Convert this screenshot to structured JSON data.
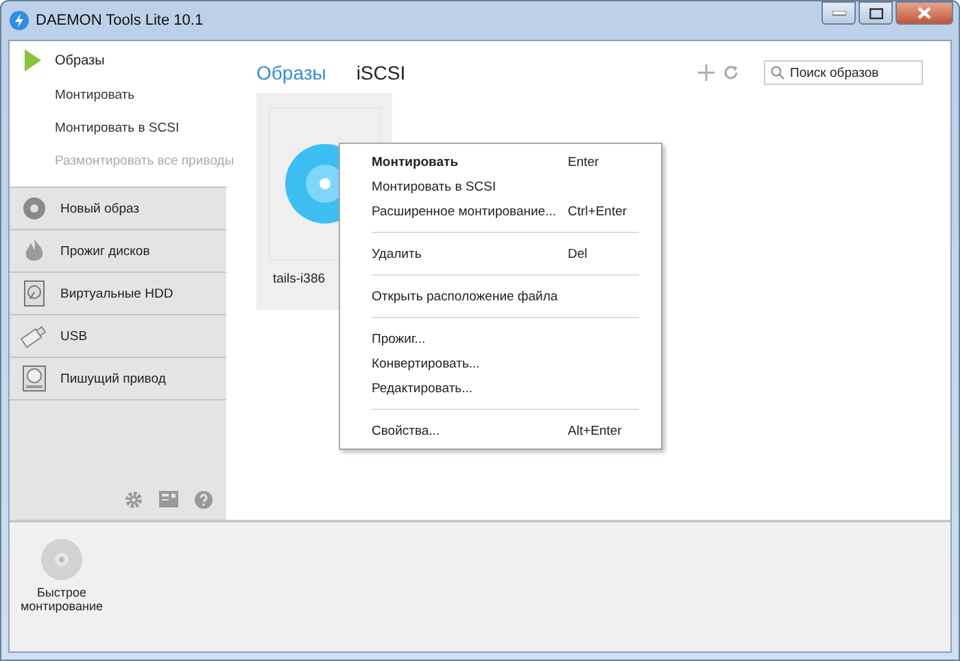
{
  "window": {
    "title": "DAEMON Tools Lite 10.1"
  },
  "sidebar": {
    "header": {
      "label": "Образы",
      "selected": true
    },
    "actions": [
      {
        "label": "Монтировать",
        "disabled": false
      },
      {
        "label": "Монтировать в SCSI",
        "disabled": false
      },
      {
        "label": "Размонтировать все приводы",
        "disabled": true
      }
    ],
    "sections": [
      {
        "label": "Новый образ"
      },
      {
        "label": "Прожиг дисков"
      },
      {
        "label": "Виртуальные HDD"
      },
      {
        "label": "USB"
      },
      {
        "label": "Пишущий привод"
      }
    ]
  },
  "tabs": [
    {
      "label": "Образы",
      "selected": true
    },
    {
      "label": "iSCSI",
      "selected": false
    }
  ],
  "search": {
    "placeholder": "Поиск образов"
  },
  "images": [
    {
      "name": "tails-i386"
    }
  ],
  "context_menu": [
    {
      "kind": "item",
      "label": "Монтировать",
      "shortcut": "Enter",
      "default": true
    },
    {
      "kind": "item",
      "label": "Монтировать в SCSI",
      "default": false
    },
    {
      "kind": "item",
      "label": "Расширенное монтирование...",
      "shortcut": "Ctrl+Enter",
      "default": false
    },
    {
      "kind": "separator"
    },
    {
      "kind": "item",
      "label": "Удалить",
      "shortcut": "Del",
      "default": false
    },
    {
      "kind": "separator"
    },
    {
      "kind": "item",
      "label": "Открыть расположение файла",
      "default": false
    },
    {
      "kind": "separator"
    },
    {
      "kind": "item",
      "label": "Прожиг...",
      "default": false
    },
    {
      "kind": "item",
      "label": "Конвертировать...",
      "default": false
    },
    {
      "kind": "item",
      "label": "Редактировать...",
      "default": false
    },
    {
      "kind": "separator"
    },
    {
      "kind": "item",
      "label": "Свойства...",
      "shortcut": "Alt+Enter",
      "default": false
    }
  ],
  "quick_mount": {
    "label": "Быстрое монтирование"
  }
}
